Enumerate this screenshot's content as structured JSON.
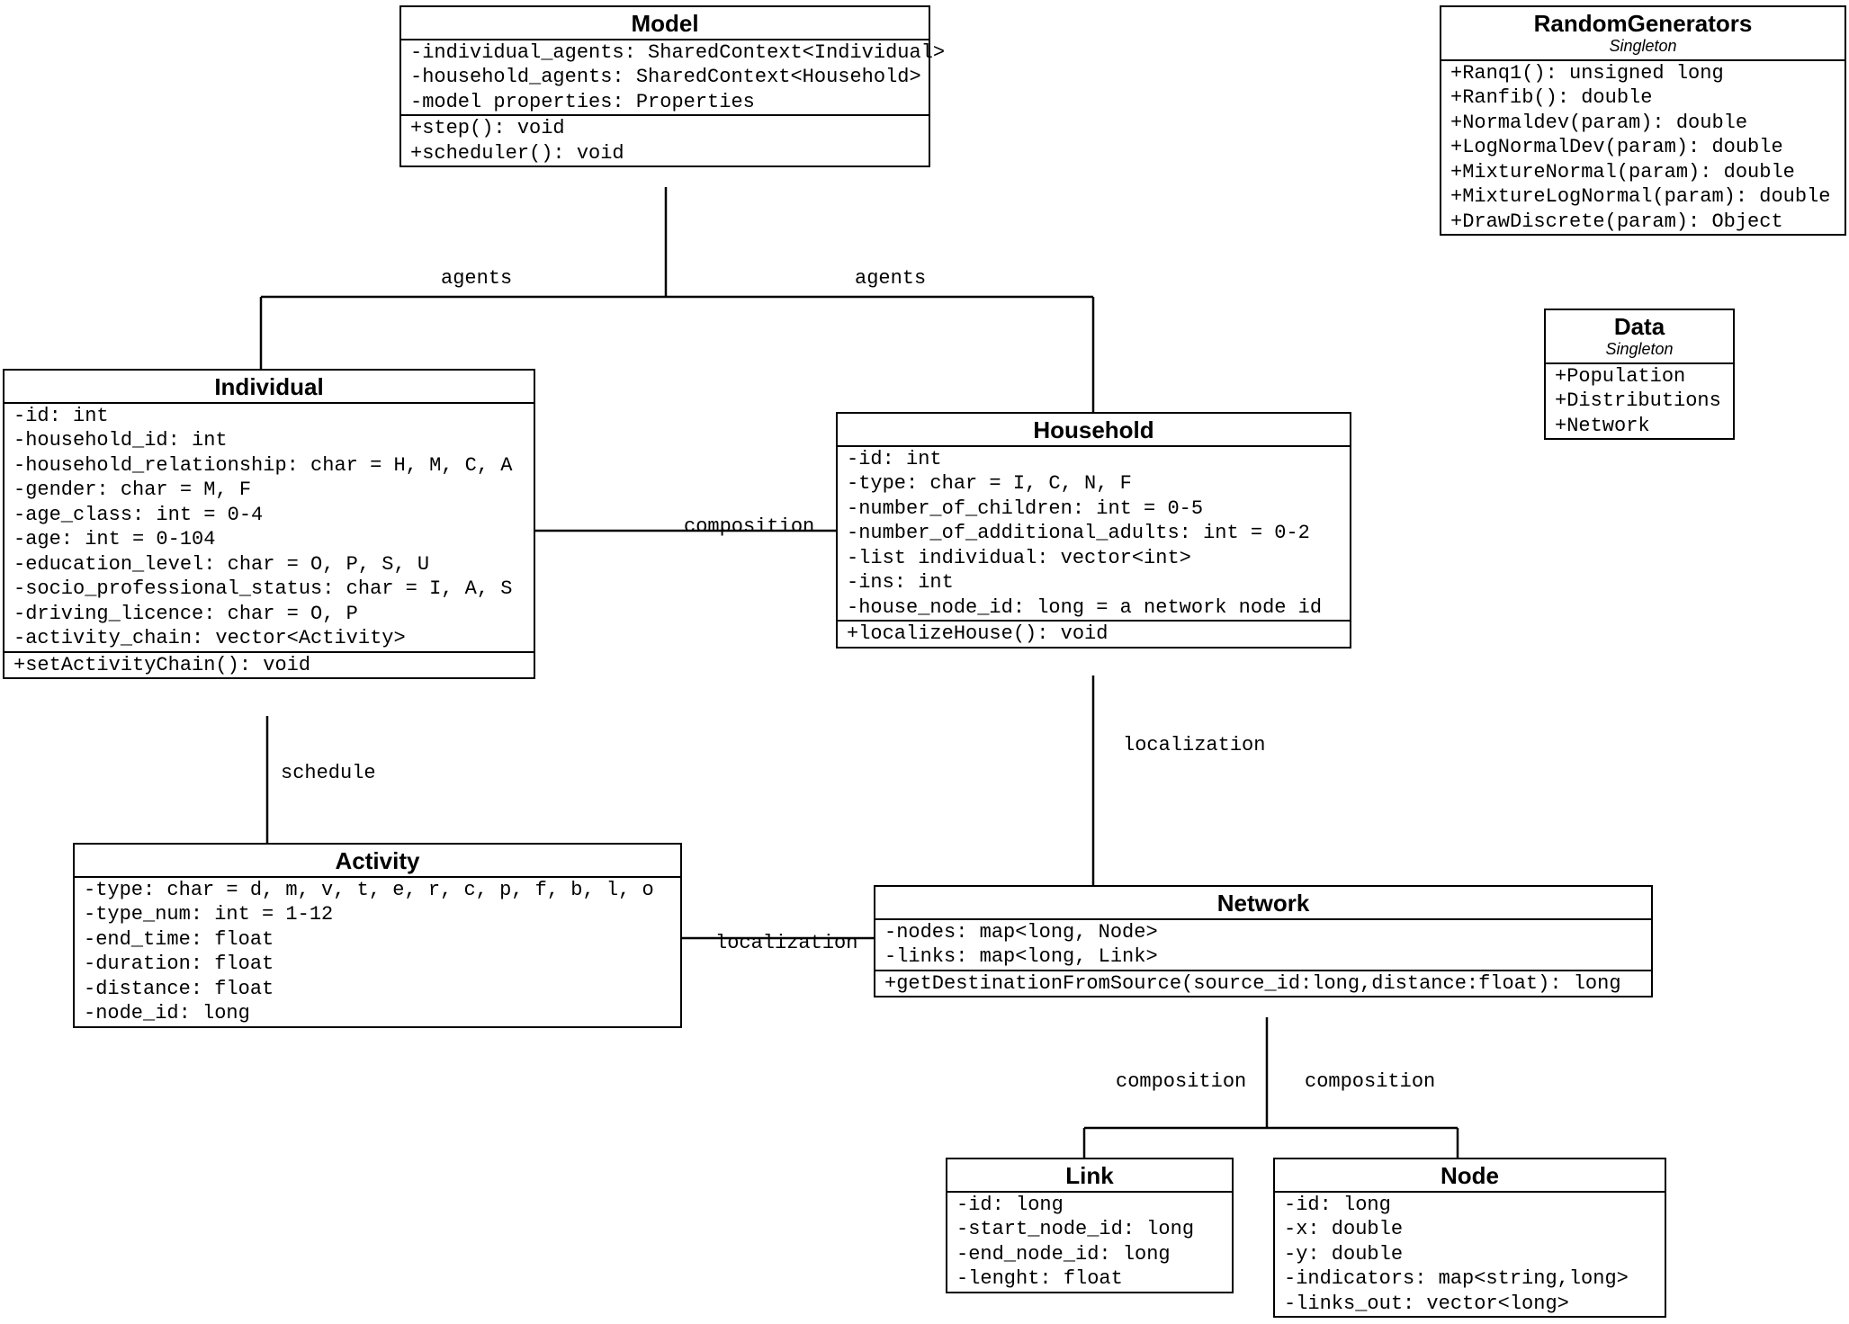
{
  "classes": {
    "model": {
      "name": "Model",
      "attrs": [
        "-individual_agents: SharedContext<Individual>",
        "-household_agents: SharedContext<Household>",
        "-model properties: Properties"
      ],
      "ops": [
        "+step(): void",
        "+scheduler(): void"
      ]
    },
    "random": {
      "name": "RandomGenerators",
      "stereo": "Singleton",
      "ops": [
        "+Ranq1(): unsigned long",
        "+Ranfib(): double",
        "+Normaldev(param): double",
        "+LogNormalDev(param): double",
        "+MixtureNormal(param): double",
        "+MixtureLogNormal(param): double",
        "+DrawDiscrete(param): Object"
      ]
    },
    "data": {
      "name": "Data",
      "stereo": "Singleton",
      "ops": [
        "+Population",
        "+Distributions",
        "+Network"
      ]
    },
    "individual": {
      "name": "Individual",
      "attrs": [
        "-id: int",
        "-household_id: int",
        "-household_relationship: char = H, M, C, A",
        "-gender: char = M, F",
        "-age_class: int = 0-4",
        "-age: int = 0-104",
        "-education_level: char = O, P, S, U",
        "-socio_professional_status: char = I, A, S",
        "-driving_licence: char = O, P",
        "-activity_chain: vector<Activity>"
      ],
      "ops": [
        "+setActivityChain(): void"
      ]
    },
    "household": {
      "name": "Household",
      "attrs": [
        "-id: int",
        "-type: char = I, C, N, F",
        "-number_of_children: int = 0-5",
        "-number_of_additional_adults: int = 0-2",
        "-list individual: vector<int>",
        "-ins: int",
        "-house_node_id: long = a network node id"
      ],
      "ops": [
        "+localizeHouse(): void"
      ]
    },
    "activity": {
      "name": "Activity",
      "attrs": [
        "-type: char = d, m, v, t, e, r, c, p, f, b, l, o",
        "-type_num: int = 1-12",
        "-end_time: float",
        "-duration: float",
        "-distance: float",
        "-node_id: long"
      ]
    },
    "network": {
      "name": "Network",
      "attrs": [
        "-nodes: map<long, Node>",
        "-links: map<long, Link>"
      ],
      "ops": [
        "+getDestinationFromSource(source_id:long,distance:float): long"
      ]
    },
    "link": {
      "name": "Link",
      "attrs": [
        "-id: long",
        "-start_node_id: long",
        "-end_node_id: long",
        "-lenght: float"
      ]
    },
    "node": {
      "name": "Node",
      "attrs": [
        "-id: long",
        "-x: double",
        "-y: double",
        "-indicators: map<string,long>",
        "-links_out: vector<long>"
      ]
    }
  },
  "labels": {
    "agents_l": "agents",
    "agents_r": "agents",
    "composition_ih": "composition",
    "schedule": "schedule",
    "localization_an": "localization",
    "localization_hn": "localization",
    "composition_nl": "composition",
    "composition_nn": "composition"
  }
}
